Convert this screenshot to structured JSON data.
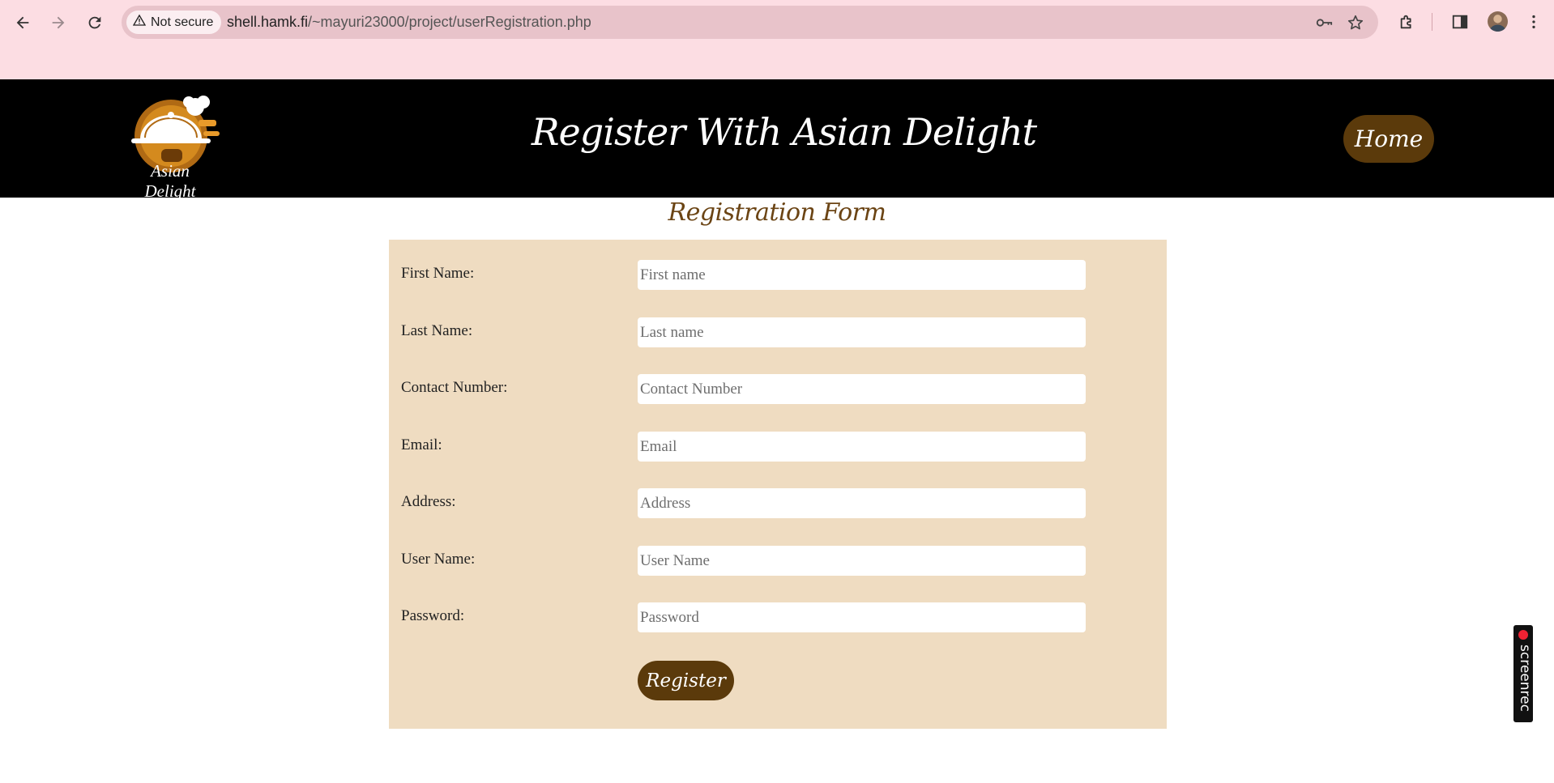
{
  "browser": {
    "security_label": "Not secure",
    "url_host": "shell.hamk.fi",
    "url_path": "/~mayuri23000/project/userRegistration.php"
  },
  "site": {
    "logo_text": "Asian Delight",
    "title": "Register With Asian Delight",
    "home_label": "Home"
  },
  "form": {
    "title": "Registration Form",
    "fields": [
      {
        "label": "First Name:",
        "placeholder": "First name"
      },
      {
        "label": "Last Name:",
        "placeholder": "Last name"
      },
      {
        "label": "Contact Number:",
        "placeholder": "Contact Number"
      },
      {
        "label": "Email:",
        "placeholder": "Email"
      },
      {
        "label": "Address:",
        "placeholder": "Address"
      },
      {
        "label": "User Name:",
        "placeholder": "User Name"
      },
      {
        "label": "Password:",
        "placeholder": "Password"
      }
    ],
    "submit_label": "Register"
  },
  "widget": {
    "screenrec_label": "screenrec"
  },
  "colors": {
    "chrome_bg": "#fcdde3",
    "header_bg": "#000000",
    "accent_brown": "#5b3a0b",
    "form_bg": "#efdcc1"
  },
  "icons": [
    "back-arrow-icon",
    "forward-arrow-icon",
    "reload-icon",
    "warning-icon",
    "key-icon",
    "star-icon",
    "extensions-icon",
    "side-panel-icon",
    "kebab-menu-icon"
  ]
}
